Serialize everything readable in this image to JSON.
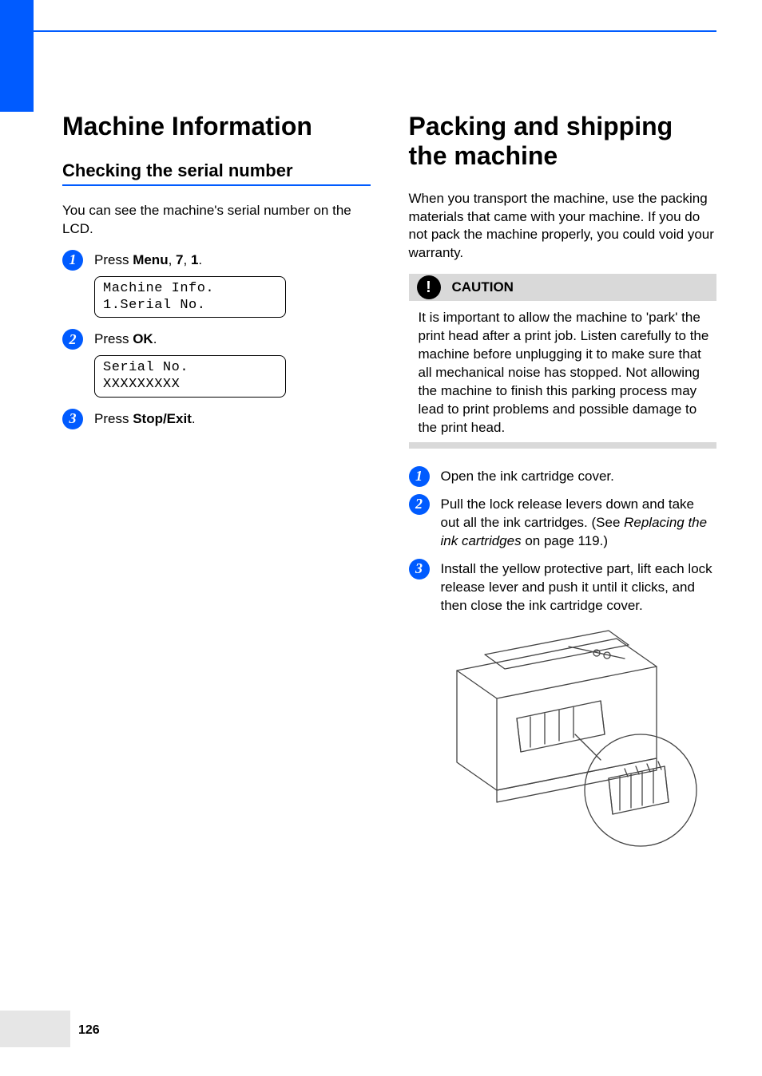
{
  "page_number": "126",
  "left": {
    "heading": "Machine Information",
    "subheading": "Checking the serial number",
    "intro": "You can see the machine's serial number on the LCD.",
    "steps": [
      {
        "num": "1",
        "text_prefix": "Press ",
        "bold1": "Menu",
        "mid1": ", ",
        "bold2": "7",
        "mid2": ", ",
        "bold3": "1",
        "suffix": ".",
        "lcd": "Machine Info.\n1.Serial No."
      },
      {
        "num": "2",
        "text_prefix": "Press ",
        "bold1": "OK",
        "suffix": ".",
        "lcd": "Serial No.\nXXXXXXXXX"
      },
      {
        "num": "3",
        "text_prefix": "Press ",
        "bold1": "Stop/Exit",
        "suffix": "."
      }
    ]
  },
  "right": {
    "heading": "Packing and shipping the machine",
    "intro": "When you transport the machine, use the packing materials that came with your machine. If you do not pack the machine properly, you could void your warranty.",
    "caution_label": "CAUTION",
    "caution_text": "It is important to allow the machine to 'park' the print head after a print job. Listen carefully to the machine before unplugging it to make sure that all mechanical noise has stopped. Not allowing the machine to finish this parking process may lead to print problems and possible damage to the print head.",
    "steps": [
      {
        "num": "1",
        "text": "Open the ink cartridge cover."
      },
      {
        "num": "2",
        "pre": "Pull the lock release levers down and take out all the ink cartridges. (See ",
        "ital": "Replacing the ink cartridges",
        "post": " on page 119.)"
      },
      {
        "num": "3",
        "text": "Install the yellow protective part, lift each lock release lever and push it until it clicks, and then close the ink cartridge cover."
      }
    ]
  }
}
